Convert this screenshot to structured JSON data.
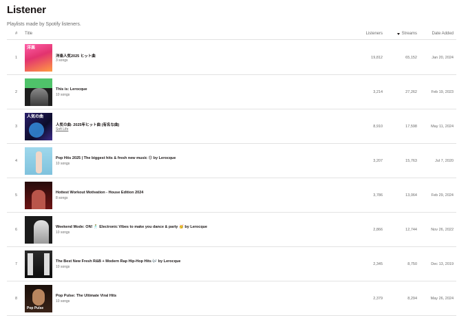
{
  "page": {
    "title": "Listener",
    "subtitle": "Playlists made by Spotify listeners."
  },
  "columns": {
    "num": "#",
    "title": "Title",
    "listeners": "Listeners",
    "streams": "Streams",
    "date_added": "Date Added",
    "sort_icon": "sort-descending-icon"
  },
  "rows": [
    {
      "index": "1",
      "name": "洋楽人気2025 ヒット曲",
      "sub": "3 songs",
      "listeners": "19,812",
      "streams": "65,152",
      "date": "Jan 20, 2024",
      "cover_text": "洋楽",
      "cover_bottom": ""
    },
    {
      "index": "2",
      "name": "This is: Lerocque",
      "sub": "10 songs",
      "listeners": "3,214",
      "streams": "27,262",
      "date": "Feb 19, 2023",
      "cover_text": "",
      "cover_bottom": ""
    },
    {
      "index": "3",
      "name": "人気の曲- 2025年ヒット曲 (有名な曲)",
      "sub": "Soft Life",
      "listeners": "8,910",
      "streams": "17,598",
      "date": "May 11, 2024",
      "cover_text": "人気の曲",
      "cover_bottom": ""
    },
    {
      "index": "4",
      "name": "Pop Hits 2025 | The biggest hits & fresh new music 😊 by Lerocque",
      "sub": "10 songs",
      "listeners": "3,207",
      "streams": "15,763",
      "date": "Jul 7, 2020",
      "cover_text": "",
      "cover_bottom": ""
    },
    {
      "index": "5",
      "name": "Hottest Workout Motivation - House Edition 2024",
      "sub": "8 songs",
      "listeners": "3,786",
      "streams": "13,064",
      "date": "Feb 29, 2024",
      "cover_text": "",
      "cover_bottom": ""
    },
    {
      "index": "6",
      "name": "Weekend Mode: ON! 🕺 Electronic Vibes to make you dance & party 🥳 by Lerocque",
      "sub": "10 songs",
      "listeners": "2,866",
      "streams": "12,744",
      "date": "Nov 26, 2022",
      "cover_text": "",
      "cover_bottom": ""
    },
    {
      "index": "7",
      "name": "The Best New Fresh R&B + Modern Rap Hip-Hop Hits 🎶 by Lerocque",
      "sub": "10 songs",
      "listeners": "2,345",
      "streams": "8,750",
      "date": "Dec 13, 2019",
      "cover_text": "",
      "cover_bottom": ""
    },
    {
      "index": "8",
      "name": "Pop Pulse: The Ultimate Viral Hits",
      "sub": "10 songs",
      "listeners": "2,379",
      "streams": "8,294",
      "date": "May 26, 2024",
      "cover_text": "",
      "cover_bottom": "Pop Pulse"
    }
  ]
}
